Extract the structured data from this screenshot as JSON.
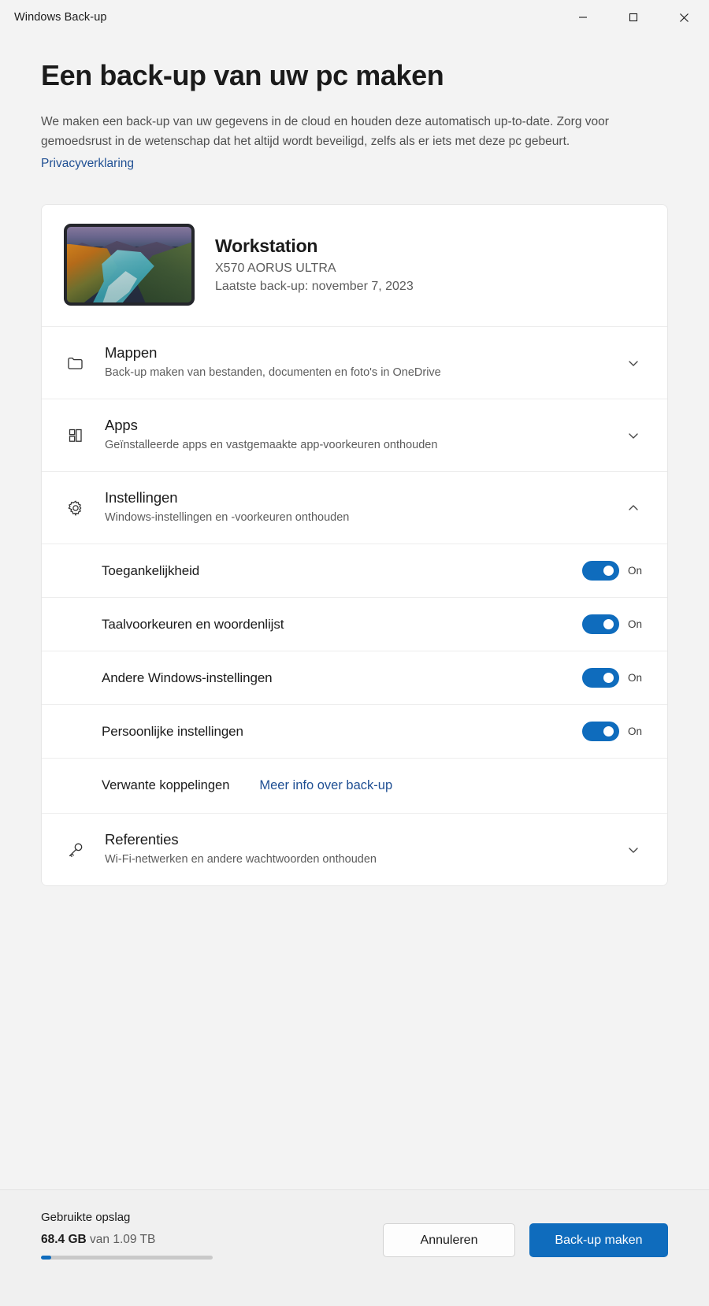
{
  "window": {
    "title": "Windows Back-up",
    "controls": {
      "minimize": "minimize-icon",
      "maximize": "maximize-icon",
      "close": "close-icon"
    }
  },
  "page": {
    "title": "Een back-up van uw pc maken",
    "description": "We maken een back-up van uw gegevens in de cloud en houden deze automatisch up-to-date. Zorg voor gemoedsrust in de wetenschap dat het altijd wordt beveiligd, zelfs als er iets met deze pc gebeurt.",
    "privacy_link": "Privacyverklaring"
  },
  "device": {
    "name": "Workstation",
    "model": "X570 AORUS ULTRA",
    "last_backup": "Laatste back-up: november 7, 2023",
    "thumbnail": "desktop-wallpaper-thumbnail"
  },
  "sections": [
    {
      "icon": "folder-icon",
      "title": "Mappen",
      "description": "Back-up maken van bestanden, documenten en foto's in OneDrive",
      "chevron": "chevron-down-icon",
      "expanded": false
    },
    {
      "icon": "apps-grid-icon",
      "title": "Apps",
      "description": "Geïnstalleerde apps en vastgemaakte app-voorkeuren onthouden",
      "chevron": "chevron-down-icon",
      "expanded": false
    },
    {
      "icon": "gear-icon",
      "title": "Instellingen",
      "description": "Windows-instellingen en -voorkeuren onthouden",
      "chevron": "chevron-up-icon",
      "expanded": true
    },
    {
      "icon": "key-icon",
      "title": "Referenties",
      "description": "Wi-Fi-netwerken en andere wachtwoorden onthouden",
      "chevron": "chevron-down-icon",
      "expanded": false
    }
  ],
  "settings_toggles": [
    {
      "label": "Toegankelijkheid",
      "state": "On",
      "on": true
    },
    {
      "label": "Taalvoorkeuren en woordenlijst",
      "state": "On",
      "on": true
    },
    {
      "label": "Andere Windows-instellingen",
      "state": "On",
      "on": true
    },
    {
      "label": "Persoonlijke instellingen",
      "state": "On",
      "on": true
    }
  ],
  "related": {
    "label": "Verwante koppelingen",
    "link": "Meer info over back-up"
  },
  "footer": {
    "storage_title": "Gebruikte opslag",
    "storage_used": "68.4 GB",
    "storage_total": "van 1.09 TB",
    "storage_percent": 6,
    "cancel_label": "Annuleren",
    "backup_label": "Back-up maken"
  },
  "colors": {
    "accent": "#0f6cbd",
    "link": "#1f4f93",
    "background": "#f3f3f3",
    "card": "#ffffff",
    "footer": "#f0f0f0"
  }
}
